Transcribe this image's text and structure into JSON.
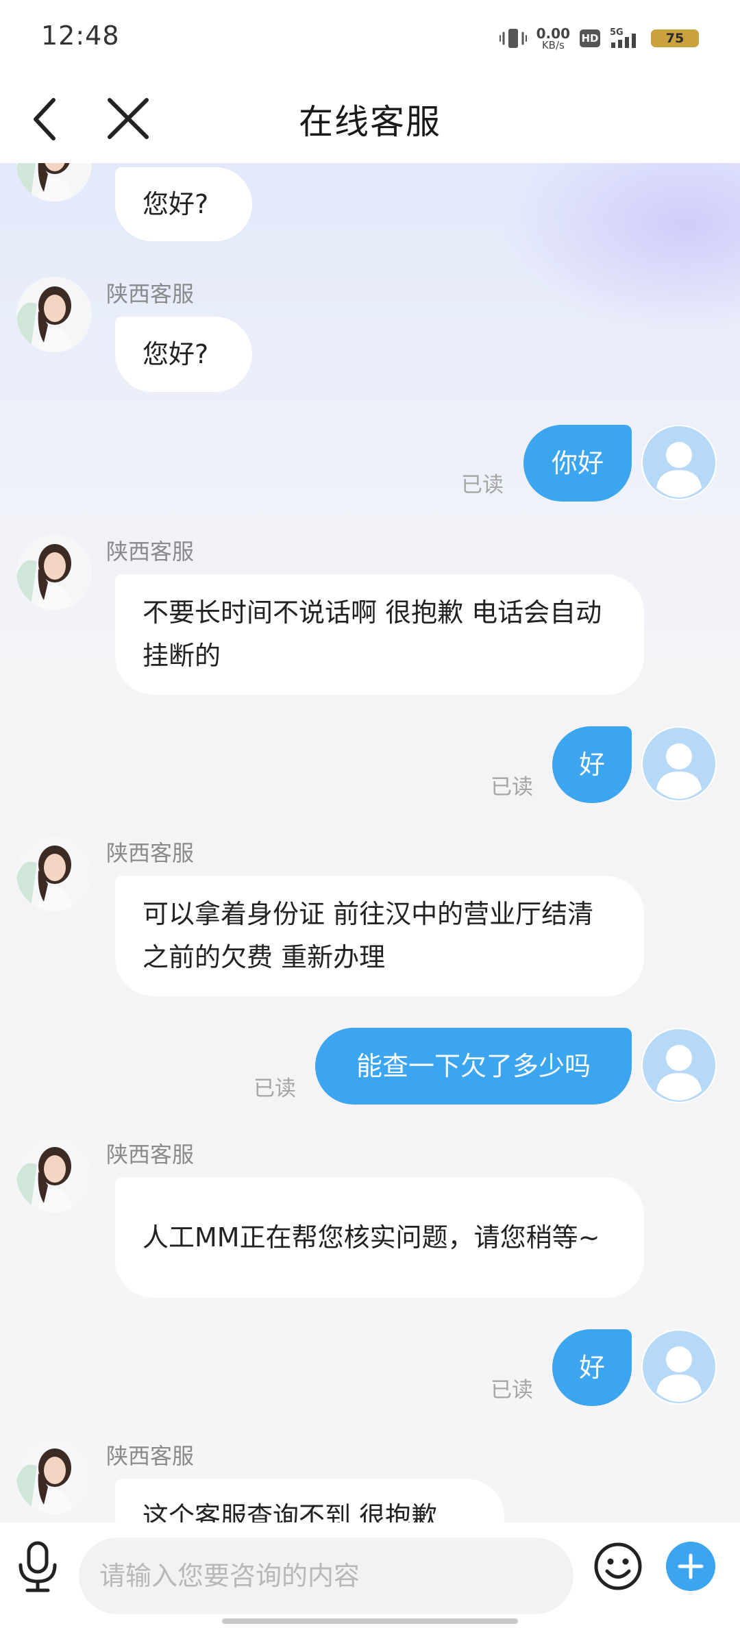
{
  "status_bar": {
    "time": "12:48",
    "net_speed_value": "0.00",
    "net_speed_unit": "KB/s",
    "hd_label": "HD",
    "network": "5G",
    "battery": "75"
  },
  "header": {
    "title": "在线客服"
  },
  "colors": {
    "accent": "#3ba5ef",
    "bubble_in": "#ffffff",
    "read_receipt": "#a5a5a5"
  },
  "messages": [
    {
      "from": "agent",
      "name": "",
      "text": "您好?"
    },
    {
      "from": "agent",
      "name": "陕西客服",
      "text": "您好?"
    },
    {
      "from": "user",
      "text": "你好",
      "status": "已读"
    },
    {
      "from": "agent",
      "name": "陕西客服",
      "text": "不要长时间不说话啊  很抱歉 电话会自动挂断的"
    },
    {
      "from": "user",
      "text": "好",
      "status": "已读"
    },
    {
      "from": "agent",
      "name": "陕西客服",
      "text": "可以拿着身份证 前往汉中的营业厅结清之前的欠费  重新办理"
    },
    {
      "from": "user",
      "text": "能查一下欠了多少吗",
      "status": "已读"
    },
    {
      "from": "agent",
      "name": "陕西客服",
      "text": "人工MM正在帮您核实问题，请您稍等~"
    },
    {
      "from": "user",
      "text": "好",
      "status": "已读"
    },
    {
      "from": "agent",
      "name": "陕西客服",
      "text": "这个客服查询不到  很抱歉"
    }
  ],
  "input": {
    "placeholder": "请输入您要咨询的内容",
    "value": ""
  },
  "icons": {
    "back": "chevron-left-icon",
    "close": "close-icon",
    "mic": "microphone-icon",
    "emoji": "smiley-icon",
    "plus": "plus-icon"
  }
}
